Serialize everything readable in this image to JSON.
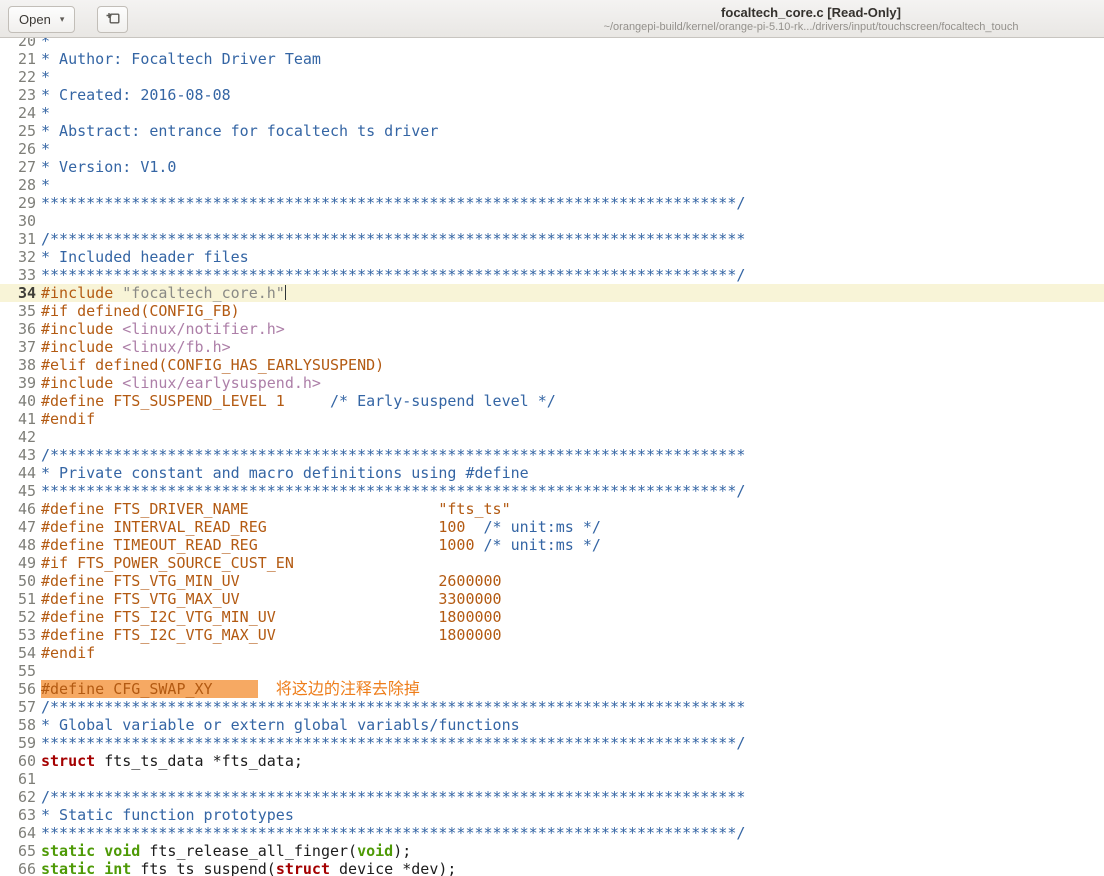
{
  "header": {
    "open_button": {
      "label": "Open",
      "caret_icon": "chevron-down-icon"
    },
    "newtab_button": {
      "icon": "new-tab-icon"
    },
    "title": "focaltech_core.c [Read-Only]",
    "subtitle": "~/orangepi-build/kernel/orange-pi-5.10-rk.../drivers/input/touchscreen/focaltech_touch"
  },
  "editor": {
    "current_line": 34,
    "colors": {
      "comment": "#3465a4",
      "preprocessor": "#b35a12",
      "string_quoted": "#8a8a86",
      "string_include": "#ad7fa8",
      "type_keyword": "#4e9a06",
      "struct_keyword": "#a40000",
      "current_line_bg": "#f8f4d7",
      "selection_bg": "#f6a963",
      "annotation": "#ee7d1a"
    },
    "annotation_text": "将这边的注释去除掉",
    "lines": [
      {
        "n": 20,
        "segs": [
          {
            "c": "comment",
            "t": "*"
          }
        ]
      },
      {
        "n": 21,
        "segs": [
          {
            "c": "comment",
            "t": "* Author: Focaltech Driver Team"
          }
        ]
      },
      {
        "n": 22,
        "segs": [
          {
            "c": "comment",
            "t": "*"
          }
        ]
      },
      {
        "n": 23,
        "segs": [
          {
            "c": "comment",
            "t": "* Created: 2016-08-08"
          }
        ]
      },
      {
        "n": 24,
        "segs": [
          {
            "c": "comment",
            "t": "*"
          }
        ]
      },
      {
        "n": 25,
        "segs": [
          {
            "c": "comment",
            "t": "* Abstract: entrance for focaltech ts driver"
          }
        ]
      },
      {
        "n": 26,
        "segs": [
          {
            "c": "comment",
            "t": "*"
          }
        ]
      },
      {
        "n": 27,
        "segs": [
          {
            "c": "comment",
            "t": "* Version: V1.0"
          }
        ]
      },
      {
        "n": 28,
        "segs": [
          {
            "c": "comment",
            "t": "*"
          }
        ]
      },
      {
        "n": 29,
        "segs": [
          {
            "c": "comment",
            "t": "*****************************************************************************/"
          }
        ]
      },
      {
        "n": 30,
        "segs": []
      },
      {
        "n": 31,
        "segs": [
          {
            "c": "comment",
            "t": "/*****************************************************************************"
          }
        ]
      },
      {
        "n": 32,
        "segs": [
          {
            "c": "comment",
            "t": "* Included header files"
          }
        ]
      },
      {
        "n": 33,
        "segs": [
          {
            "c": "comment",
            "t": "*****************************************************************************/"
          }
        ]
      },
      {
        "n": 34,
        "segs": [
          {
            "c": "preproc",
            "t": "#include "
          },
          {
            "c": "string",
            "t": "\"focaltech_core.h\"",
            "cursor": true
          }
        ]
      },
      {
        "n": 35,
        "segs": [
          {
            "c": "preproc",
            "t": "#if defined(CONFIG_FB)"
          }
        ]
      },
      {
        "n": 36,
        "segs": [
          {
            "c": "preproc",
            "t": "#include "
          },
          {
            "c": "string-include",
            "t": "<linux/notifier.h>"
          }
        ]
      },
      {
        "n": 37,
        "segs": [
          {
            "c": "preproc",
            "t": "#include "
          },
          {
            "c": "string-include",
            "t": "<linux/fb.h>"
          }
        ]
      },
      {
        "n": 38,
        "segs": [
          {
            "c": "preproc",
            "t": "#elif defined(CONFIG_HAS_EARLYSUSPEND)"
          }
        ]
      },
      {
        "n": 39,
        "segs": [
          {
            "c": "preproc",
            "t": "#include "
          },
          {
            "c": "string-include",
            "t": "<linux/earlysuspend.h>"
          }
        ]
      },
      {
        "n": 40,
        "segs": [
          {
            "c": "preproc",
            "t": "#define FTS_SUSPEND_LEVEL 1     "
          },
          {
            "c": "comment",
            "t": "/* Early-suspend level */"
          }
        ]
      },
      {
        "n": 41,
        "segs": [
          {
            "c": "preproc",
            "t": "#endif"
          }
        ]
      },
      {
        "n": 42,
        "segs": []
      },
      {
        "n": 43,
        "segs": [
          {
            "c": "comment",
            "t": "/*****************************************************************************"
          }
        ]
      },
      {
        "n": 44,
        "segs": [
          {
            "c": "comment",
            "t": "* Private constant and macro definitions using #define"
          }
        ]
      },
      {
        "n": 45,
        "segs": [
          {
            "c": "comment",
            "t": "*****************************************************************************/"
          }
        ]
      },
      {
        "n": 46,
        "segs": [
          {
            "c": "preproc",
            "t": "#define FTS_DRIVER_NAME                     \"fts_ts\""
          }
        ]
      },
      {
        "n": 47,
        "segs": [
          {
            "c": "preproc",
            "t": "#define INTERVAL_READ_REG                   100  "
          },
          {
            "c": "comment",
            "t": "/* unit:ms */"
          }
        ]
      },
      {
        "n": 48,
        "segs": [
          {
            "c": "preproc",
            "t": "#define TIMEOUT_READ_REG                    1000 "
          },
          {
            "c": "comment",
            "t": "/* unit:ms */"
          }
        ]
      },
      {
        "n": 49,
        "segs": [
          {
            "c": "preproc",
            "t": "#if FTS_POWER_SOURCE_CUST_EN"
          }
        ]
      },
      {
        "n": 50,
        "segs": [
          {
            "c": "preproc",
            "t": "#define FTS_VTG_MIN_UV                      2600000"
          }
        ]
      },
      {
        "n": 51,
        "segs": [
          {
            "c": "preproc",
            "t": "#define FTS_VTG_MAX_UV                      3300000"
          }
        ]
      },
      {
        "n": 52,
        "segs": [
          {
            "c": "preproc",
            "t": "#define FTS_I2C_VTG_MIN_UV                  1800000"
          }
        ]
      },
      {
        "n": 53,
        "segs": [
          {
            "c": "preproc",
            "t": "#define FTS_I2C_VTG_MAX_UV                  1800000"
          }
        ]
      },
      {
        "n": 54,
        "segs": [
          {
            "c": "preproc",
            "t": "#endif"
          }
        ]
      },
      {
        "n": 55,
        "segs": []
      },
      {
        "n": 56,
        "segs": [
          {
            "c": "preproc selected",
            "t": "#define CFG_SWAP_XY",
            "name": "selected-text"
          },
          {
            "c": "selected",
            "t": "     "
          },
          {
            "c": "plain",
            "t": "  "
          },
          {
            "c": "annotation",
            "t": "将这边的注释去除掉",
            "name": "annotation-text"
          }
        ]
      },
      {
        "n": 57,
        "segs": [
          {
            "c": "comment",
            "t": "/*****************************************************************************"
          }
        ]
      },
      {
        "n": 58,
        "segs": [
          {
            "c": "comment",
            "t": "* Global variable or extern global variabls/functions"
          }
        ]
      },
      {
        "n": 59,
        "segs": [
          {
            "c": "comment",
            "t": "*****************************************************************************/"
          }
        ]
      },
      {
        "n": 60,
        "segs": [
          {
            "c": "struct",
            "t": "struct"
          },
          {
            "c": "plain",
            "t": " fts_ts_data *fts_data;"
          }
        ]
      },
      {
        "n": 61,
        "segs": []
      },
      {
        "n": 62,
        "segs": [
          {
            "c": "comment",
            "t": "/*****************************************************************************"
          }
        ]
      },
      {
        "n": 63,
        "segs": [
          {
            "c": "comment",
            "t": "* Static function prototypes"
          }
        ]
      },
      {
        "n": 64,
        "segs": [
          {
            "c": "comment",
            "t": "*****************************************************************************/"
          }
        ]
      },
      {
        "n": 65,
        "segs": [
          {
            "c": "type",
            "t": "static void"
          },
          {
            "c": "plain",
            "t": " fts_release_all_finger("
          },
          {
            "c": "type",
            "t": "void"
          },
          {
            "c": "plain",
            "t": ");"
          }
        ]
      },
      {
        "n": 66,
        "segs": [
          {
            "c": "type",
            "t": "static int"
          },
          {
            "c": "plain",
            "t": " fts_ts_suspend("
          },
          {
            "c": "struct",
            "t": "struct"
          },
          {
            "c": "plain",
            "t": " device *dev);"
          }
        ]
      }
    ]
  }
}
